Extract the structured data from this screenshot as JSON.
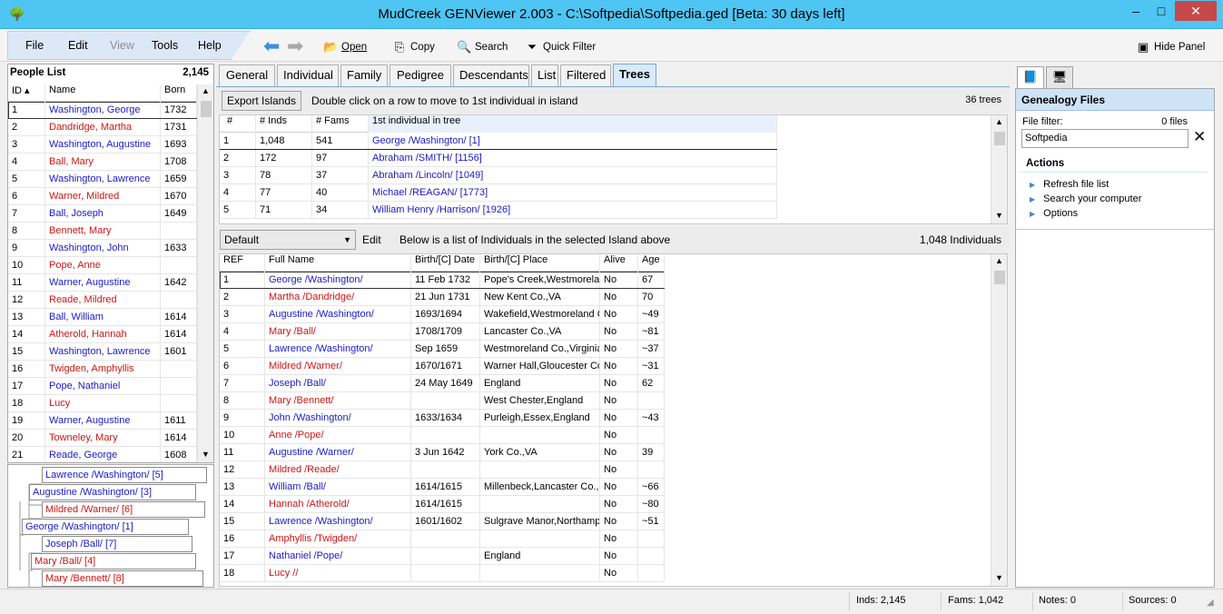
{
  "window": {
    "title": "MudCreek GENViewer 2.003 - C:\\Softpedia\\Softpedia.ged [Beta: 30 days left]",
    "min_glyph": "–",
    "max_glyph": "□",
    "close_glyph": "✕"
  },
  "menu": [
    "File",
    "Edit",
    "View",
    "Tools",
    "Help"
  ],
  "toolbar": {
    "open": "Open",
    "copy": "Copy",
    "search": "Search",
    "quick_filter": "Quick Filter",
    "hide_panel": "Hide Panel"
  },
  "people": {
    "title": "People List",
    "count": "2,145",
    "columns": [
      "ID",
      "Name",
      "Born"
    ],
    "rows": [
      {
        "id": "1",
        "name": "Washington, George",
        "born": "1732",
        "sex": "m"
      },
      {
        "id": "2",
        "name": "Dandridge, Martha",
        "born": "1731",
        "sex": "f"
      },
      {
        "id": "3",
        "name": "Washington, Augustine",
        "born": "1693",
        "sex": "m"
      },
      {
        "id": "4",
        "name": "Ball, Mary",
        "born": "1708",
        "sex": "f"
      },
      {
        "id": "5",
        "name": "Washington, Lawrence",
        "born": "1659",
        "sex": "m"
      },
      {
        "id": "6",
        "name": "Warner, Mildred",
        "born": "1670",
        "sex": "f"
      },
      {
        "id": "7",
        "name": "Ball, Joseph",
        "born": "1649",
        "sex": "m"
      },
      {
        "id": "8",
        "name": "Bennett, Mary",
        "born": "",
        "sex": "f"
      },
      {
        "id": "9",
        "name": "Washington, John",
        "born": "1633",
        "sex": "m"
      },
      {
        "id": "10",
        "name": "Pope, Anne",
        "born": "",
        "sex": "f"
      },
      {
        "id": "11",
        "name": "Warner, Augustine",
        "born": "1642",
        "sex": "m"
      },
      {
        "id": "12",
        "name": "Reade, Mildred",
        "born": "",
        "sex": "f"
      },
      {
        "id": "13",
        "name": "Ball, William",
        "born": "1614",
        "sex": "m"
      },
      {
        "id": "14",
        "name": "Atherold, Hannah",
        "born": "1614",
        "sex": "f"
      },
      {
        "id": "15",
        "name": "Washington, Lawrence",
        "born": "1601",
        "sex": "m"
      },
      {
        "id": "16",
        "name": "Twigden, Amphyllis",
        "born": "",
        "sex": "f"
      },
      {
        "id": "17",
        "name": "Pope, Nathaniel",
        "born": "",
        "sex": "m"
      },
      {
        "id": "18",
        "name": "Lucy",
        "born": "",
        "sex": "f"
      },
      {
        "id": "19",
        "name": "Warner, Augustine",
        "born": "1611",
        "sex": "m"
      },
      {
        "id": "20",
        "name": "Towneley, Mary",
        "born": "1614",
        "sex": "f"
      },
      {
        "id": "21",
        "name": "Reade, George",
        "born": "1608",
        "sex": "m"
      }
    ]
  },
  "tree": [
    {
      "label": "Lawrence /Washington/ [5]",
      "sex": "m"
    },
    {
      "label": "Augustine /Washington/ [3]",
      "sex": "m"
    },
    {
      "label": "Mildred /Warner/ [6]",
      "sex": "f"
    },
    {
      "label": "George /Washington/ [1]",
      "sex": "m"
    },
    {
      "label": "Joseph /Ball/ [7]",
      "sex": "m"
    },
    {
      "label": "Mary /Ball/ [4]",
      "sex": "f"
    },
    {
      "label": "Mary /Bennett/ [8]",
      "sex": "f"
    }
  ],
  "tabs": [
    "General",
    "Individual",
    "Family",
    "Pedigree",
    "Descendants",
    "List",
    "Filtered",
    "Trees"
  ],
  "islands": {
    "export_label": "Export Islands",
    "hint": "Double click on a row to move to 1st individual in island",
    "count": "36 trees",
    "columns": [
      "#",
      "# Inds",
      "# Fams",
      "1st individual in tree"
    ],
    "rows": [
      {
        "n": "1",
        "inds": "1,048",
        "fams": "541",
        "first": "George /Washington/ [1]"
      },
      {
        "n": "2",
        "inds": "172",
        "fams": "97",
        "first": "Abraham /SMITH/ [1156]"
      },
      {
        "n": "3",
        "inds": "78",
        "fams": "37",
        "first": "Abraham /Lincoln/ [1049]"
      },
      {
        "n": "4",
        "inds": "77",
        "fams": "40",
        "first": "Michael /REAGAN/ [1773]"
      },
      {
        "n": "5",
        "inds": "71",
        "fams": "34",
        "first": "William Henry /Harrison/ [1926]"
      }
    ]
  },
  "individuals": {
    "view_select": "Default",
    "edit_label": "Edit",
    "hint": "Below is a list of Individuals in the selected Island above",
    "count": "1,048 Individuals",
    "columns": [
      "REF",
      "Full Name",
      "Birth/[C] Date",
      "Birth/[C] Place",
      "Alive",
      "Age"
    ],
    "rows": [
      {
        "ref": "1",
        "name": "George /Washington/",
        "date": "11 Feb 1732",
        "place": "Pope's Creek,Westmoreland",
        "alive": "No",
        "age": "67",
        "sex": "m"
      },
      {
        "ref": "2",
        "name": "Martha /Dandridge/",
        "date": "21 Jun 1731",
        "place": "New Kent Co.,VA",
        "alive": "No",
        "age": "70",
        "sex": "f"
      },
      {
        "ref": "3",
        "name": "Augustine /Washington/",
        "date": "1693/1694",
        "place": "Wakefield,Westmoreland C",
        "alive": "No",
        "age": "~49",
        "sex": "m"
      },
      {
        "ref": "4",
        "name": "Mary /Ball/",
        "date": "1708/1709",
        "place": "Lancaster Co.,VA",
        "alive": "No",
        "age": "~81",
        "sex": "f"
      },
      {
        "ref": "5",
        "name": "Lawrence /Washington/",
        "date": "Sep 1659",
        "place": "Westmoreland Co.,Virginia",
        "alive": "No",
        "age": "~37",
        "sex": "m"
      },
      {
        "ref": "6",
        "name": "Mildred /Warner/",
        "date": "1670/1671",
        "place": "Warner Hall,Gloucester Co",
        "alive": "No",
        "age": "~31",
        "sex": "f"
      },
      {
        "ref": "7",
        "name": "Joseph /Ball/",
        "date": "24 May 1649",
        "place": "England",
        "alive": "No",
        "age": "62",
        "sex": "m"
      },
      {
        "ref": "8",
        "name": "Mary /Bennett/",
        "date": "",
        "place": "West Chester,England",
        "alive": "No",
        "age": "",
        "sex": "f"
      },
      {
        "ref": "9",
        "name": "John /Washington/",
        "date": "1633/1634",
        "place": "Purleigh,Essex,England",
        "alive": "No",
        "age": "~43",
        "sex": "m"
      },
      {
        "ref": "10",
        "name": "Anne /Pope/",
        "date": "",
        "place": "",
        "alive": "No",
        "age": "",
        "sex": "f"
      },
      {
        "ref": "11",
        "name": "Augustine /Warner/",
        "date": "3 Jun 1642",
        "place": "York Co.,VA",
        "alive": "No",
        "age": "39",
        "sex": "m"
      },
      {
        "ref": "12",
        "name": "Mildred /Reade/",
        "date": "",
        "place": "",
        "alive": "No",
        "age": "",
        "sex": "f"
      },
      {
        "ref": "13",
        "name": "William /Ball/",
        "date": "1614/1615",
        "place": "Millenbeck,Lancaster Co.,E",
        "alive": "No",
        "age": "~66",
        "sex": "m"
      },
      {
        "ref": "14",
        "name": "Hannah /Atherold/",
        "date": "1614/1615",
        "place": "",
        "alive": "No",
        "age": "~80",
        "sex": "f"
      },
      {
        "ref": "15",
        "name": "Lawrence /Washington/",
        "date": "1601/1602",
        "place": "Sulgrave Manor,Northampt",
        "alive": "No",
        "age": "~51",
        "sex": "m"
      },
      {
        "ref": "16",
        "name": "Amphyllis /Twigden/",
        "date": "",
        "place": "",
        "alive": "No",
        "age": "",
        "sex": "f"
      },
      {
        "ref": "17",
        "name": "Nathaniel /Pope/",
        "date": "",
        "place": "England",
        "alive": "No",
        "age": "",
        "sex": "m"
      },
      {
        "ref": "18",
        "name": "Lucy //",
        "date": "",
        "place": "",
        "alive": "No",
        "age": "",
        "sex": "f"
      }
    ]
  },
  "right_panel": {
    "header": "Genealogy Files",
    "file_filter_label": "File filter:",
    "file_count": "0 files",
    "filter_value": "Softpedia",
    "actions_header": "Actions",
    "actions": [
      "Refresh file list",
      "Search your computer",
      "Options"
    ]
  },
  "status": {
    "inds": "Inds: 2,145",
    "fams": "Fams: 1,042",
    "notes": "Notes: 0",
    "sources": "Sources: 0"
  },
  "colors": {
    "male": "#1a1ac8",
    "female": "#d01414",
    "titlebar": "#4ec5f2",
    "close": "#c74848"
  }
}
